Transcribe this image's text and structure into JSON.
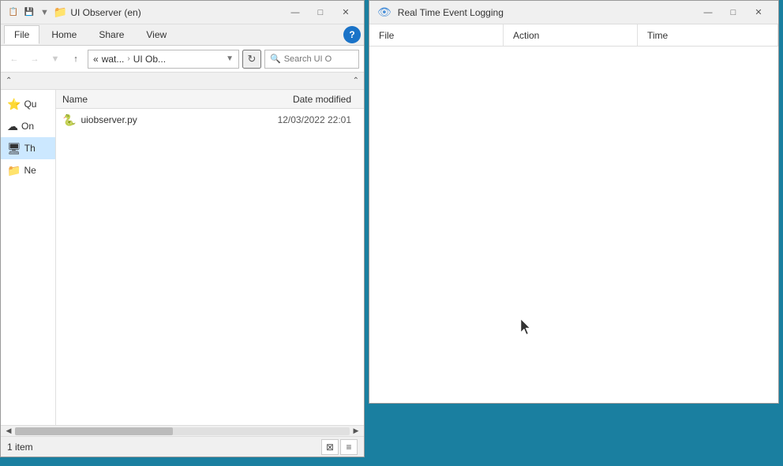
{
  "explorer": {
    "title": "UI Observer (en)",
    "titlebar_icons": [
      "📋",
      "💾"
    ],
    "ribbon_tabs": [
      {
        "label": "File",
        "active": true
      },
      {
        "label": "Home",
        "active": false
      },
      {
        "label": "Share",
        "active": false
      },
      {
        "label": "View",
        "active": false
      }
    ],
    "address": {
      "back_enabled": false,
      "forward_enabled": false,
      "up_enabled": true,
      "path_segments": [
        "wat...",
        "UI Ob..."
      ],
      "search_placeholder": "Search UI O"
    },
    "columns": [
      {
        "label": "Name",
        "class": "file-col-name"
      },
      {
        "label": "Date modified",
        "class": "file-col-date"
      }
    ],
    "sidebar_items": [
      {
        "label": "Qu",
        "icon": "⭐",
        "active": false
      },
      {
        "label": "On",
        "icon": "☁",
        "active": false
      },
      {
        "label": "Th",
        "icon": "🖥",
        "active": true
      },
      {
        "label": "Ne",
        "icon": "📁",
        "active": false
      }
    ],
    "files": [
      {
        "name": "uiobserver.py",
        "icon": "🐍",
        "date_modified": "12/03/2022 22:01"
      }
    ],
    "status": {
      "count": "1 item"
    },
    "view_buttons": [
      "⊞",
      "≡"
    ]
  },
  "logger": {
    "title": "Real Time Event Logging",
    "columns": [
      {
        "label": "File",
        "key": "file"
      },
      {
        "label": "Action",
        "key": "action"
      },
      {
        "label": "Time",
        "key": "time"
      }
    ],
    "entries": []
  },
  "window_controls": {
    "minimize": "—",
    "maximize": "□",
    "close": "✕"
  }
}
